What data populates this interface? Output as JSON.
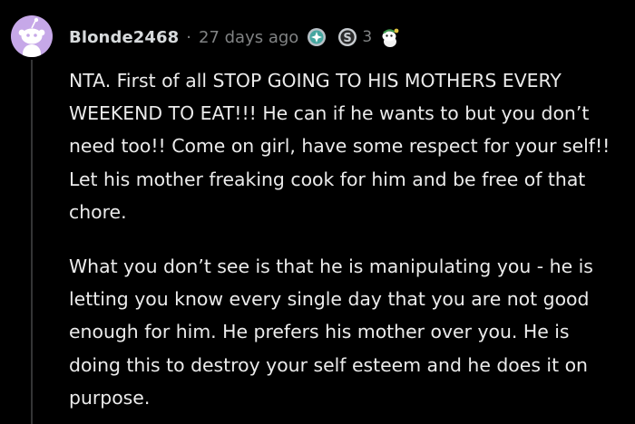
{
  "comment": {
    "username": "Blonde2468",
    "separator": "·",
    "timestamp": "27 days ago",
    "awards": [
      {
        "icon": "helpful-award-icon"
      },
      {
        "icon": "silver-award-icon",
        "count": "3"
      },
      {
        "icon": "wholesome-award-icon"
      }
    ],
    "paragraphs": [
      "NTA. First of all STOP GOING TO HIS MOTHERS EVERY WEEKEND TO EAT!!! He can if he wants to but you don’t need too!! Come on girl, have some respect for your self!! Let his mother freaking cook for him and be free of that chore.",
      "What you don’t see is that he is manipulating you - he is letting you know every single day that you are not good enough for him. He prefers his mother over you. He is doing this to destroy your self esteem and he does it on purpose."
    ]
  },
  "colors": {
    "background": "#000000",
    "avatar_bg": "#c6a8e8",
    "username": "#d7dadc",
    "meta": "#818384",
    "body_text": "#ebebeb",
    "thread_line": "#343536"
  }
}
